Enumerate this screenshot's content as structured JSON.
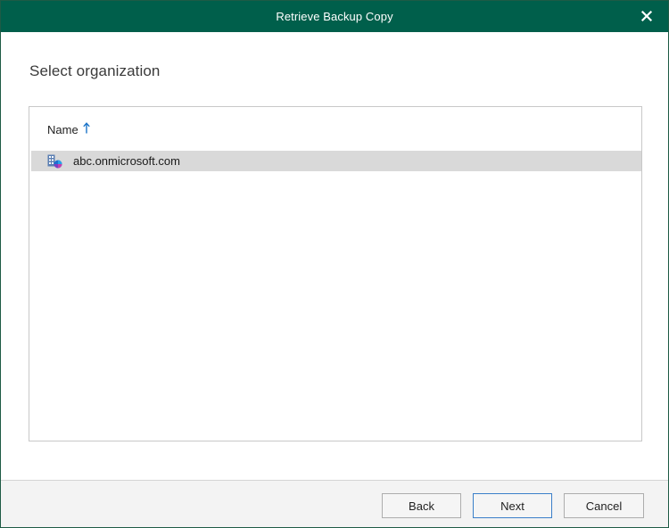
{
  "window": {
    "title": "Retrieve Backup Copy",
    "close_icon": "close-icon"
  },
  "main": {
    "heading": "Select organization",
    "list": {
      "column_header": "Name",
      "sort": "ascending",
      "rows": [
        {
          "label": "abc.onmicrosoft.com",
          "icon": "organization-icon",
          "selected": true
        }
      ]
    }
  },
  "footer": {
    "back_label": "Back",
    "next_label": "Next",
    "cancel_label": "Cancel"
  },
  "colors": {
    "titlebar": "#005f4b",
    "selection": "#d9d9d9",
    "sort_arrow": "#1a73c8",
    "default_button_border": "#3a7fc9"
  }
}
